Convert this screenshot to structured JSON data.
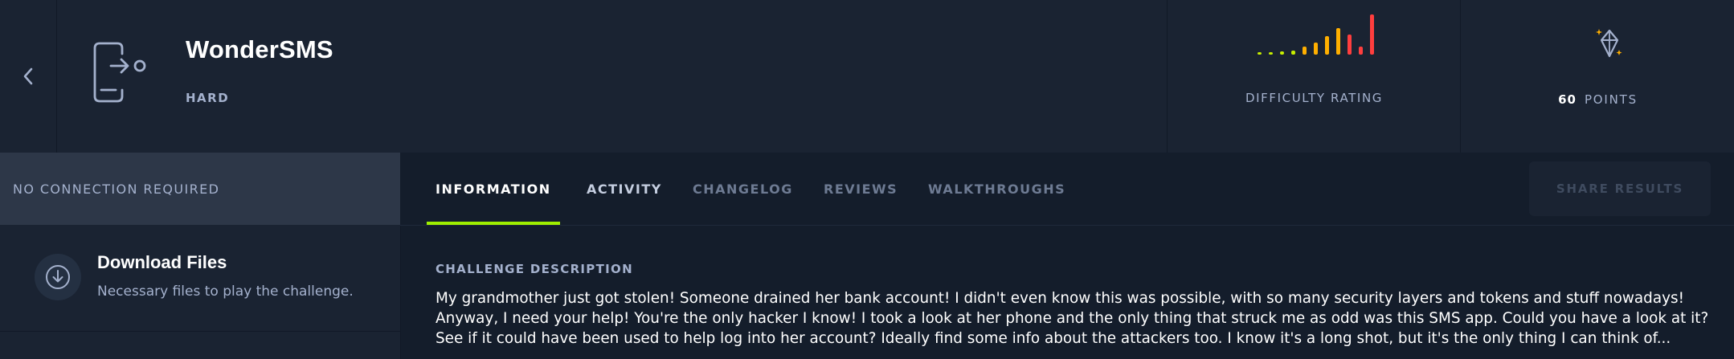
{
  "header": {
    "back_icon": "chevron-left-icon",
    "challenge_icon": "phone-exit-icon",
    "name": "WonderSMS",
    "difficulty": "HARD",
    "difficulty_rating_label": "DIFFICULTY RATING",
    "difficulty_rating_levels": [
      0.06,
      0.06,
      0.08,
      0.1,
      0.2,
      0.3,
      0.46,
      0.66,
      0.5,
      0.2,
      1.0
    ],
    "points_value": "60",
    "points_label": "POINTS",
    "points_icon": "diamond-sparkle-icon"
  },
  "sidebar": {
    "connection_label": "NO CONNECTION REQUIRED",
    "download": {
      "icon": "download-icon",
      "title": "Download Files",
      "subtitle": "Necessary files to play the challenge."
    }
  },
  "tabs": [
    {
      "label": "INFORMATION",
      "active": true
    },
    {
      "label": "ACTIVITY",
      "active": false
    },
    {
      "label": "CHANGELOG",
      "active": false
    },
    {
      "label": "REVIEWS",
      "active": false
    },
    {
      "label": "WALKTHROUGHS",
      "active": false
    }
  ],
  "share_button_label": "SHARE RESULTS",
  "main": {
    "section_title": "CHALLENGE DESCRIPTION",
    "description": "My grandmother just got stolen! Someone drained her bank account! I didn't even know this was possible, with so many security layers and tokens and stuff nowadays! Anyway, I need your help! You're the only hacker I know! I took a look at her phone and the only thing that struck me as odd was this SMS app. Could you have a look at it? See if it could have been used to help log into her account? Ideally find some info about the attackers too. I know it's a long shot, but it's the only thing I can think of..."
  },
  "colors": {
    "background": "#141d2b",
    "panel": "#1a2332",
    "accent": "#9fef00",
    "muted_text": "#a4b1cd",
    "rating_low": "#c8ef00",
    "rating_mid": "#ffaf00",
    "rating_high": "#ff3e3e"
  }
}
